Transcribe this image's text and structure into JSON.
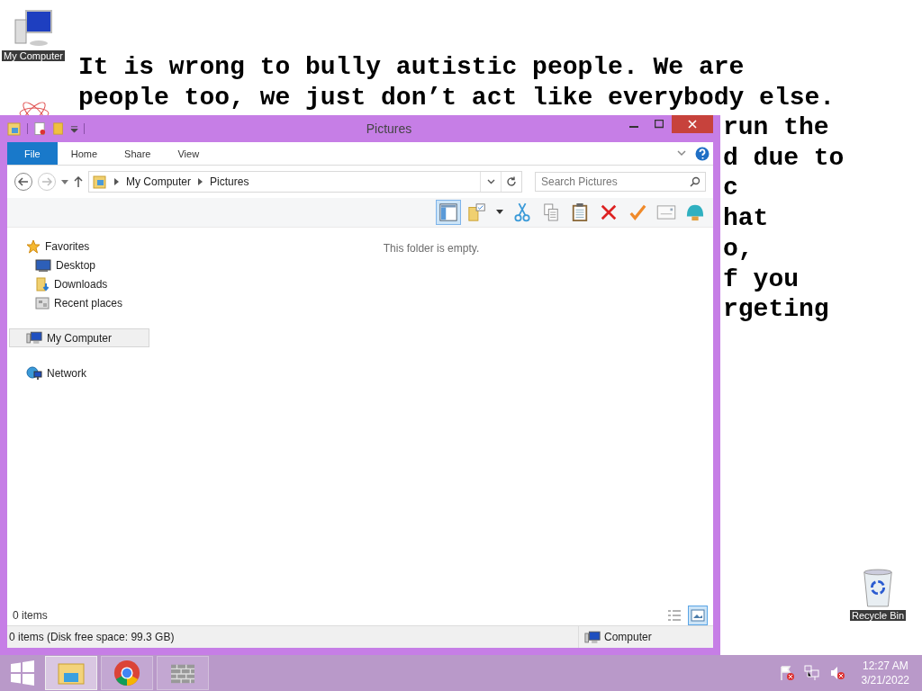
{
  "desktop": {
    "icons": [
      {
        "kind": "computer",
        "label": "My Computer"
      },
      {
        "kind": "atom"
      },
      {
        "kind": "recycle",
        "label": "Recycle Bin"
      }
    ],
    "wallpaper_lines": [
      "It is wrong to bully autistic people. We are",
      "people too, we just don’t act like everybody else."
    ],
    "wallpaper_fragments": [
      "run the",
      "d due to",
      "c",
      "hat",
      "o,",
      "f you",
      "rgeting"
    ]
  },
  "window": {
    "title": "Pictures",
    "ribbon_tabs": [
      {
        "kind": "file",
        "label": "File"
      },
      {
        "kind": "tab",
        "label": "Home"
      },
      {
        "kind": "tab",
        "label": "Share"
      },
      {
        "kind": "tab",
        "label": "View"
      }
    ],
    "breadcrumbs": [
      "My Computer",
      "Pictures"
    ],
    "search": {
      "placeholder": "Search Pictures"
    },
    "toolbar": [
      {
        "kind": "pane",
        "selected": true
      },
      {
        "kind": "folder",
        "selected": false
      },
      {
        "kind": "caret",
        "selected": false
      },
      {
        "kind": "cut",
        "selected": false
      },
      {
        "kind": "copy",
        "selected": false
      },
      {
        "kind": "paste",
        "selected": false
      },
      {
        "kind": "delete",
        "selected": false
      },
      {
        "kind": "check",
        "selected": false
      },
      {
        "kind": "mail",
        "selected": false
      },
      {
        "kind": "shell",
        "selected": false
      }
    ],
    "navigation": [
      {
        "kind": "star",
        "label": "Favorites",
        "selected": false,
        "children": [
          {
            "kind": "desktop",
            "label": "Desktop",
            "selected": false
          },
          {
            "kind": "download",
            "label": "Downloads",
            "selected": false
          },
          {
            "kind": "recent",
            "label": "Recent places",
            "selected": false
          }
        ]
      },
      {
        "kind": "computer",
        "label": "My Computer",
        "selected": true
      },
      {
        "kind": "network",
        "label": "Network",
        "selected": false
      }
    ],
    "empty_message": "This folder is empty.",
    "item_count": "0 items",
    "views": [
      {
        "kind": "details",
        "selected": false
      },
      {
        "kind": "large",
        "selected": true
      }
    ],
    "status_bar": {
      "summary": "0 items (Disk free space: 99.3 GB)",
      "location": "Computer"
    }
  },
  "taskbar": {
    "apps": [
      {
        "kind": "explorer",
        "selected": true
      },
      {
        "kind": "chrome",
        "selected": false
      },
      {
        "kind": "wall",
        "selected": false
      }
    ],
    "clock": {
      "time": "12:27 AM",
      "date": "3/21/2022"
    }
  }
}
